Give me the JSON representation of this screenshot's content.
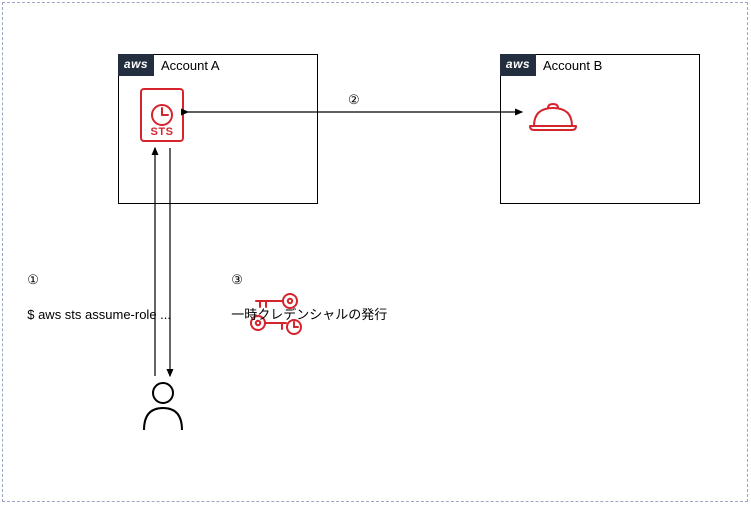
{
  "aws_badge": "aws",
  "accounts": {
    "a": {
      "title": "Account A"
    },
    "b": {
      "title": "Account B"
    }
  },
  "sts": {
    "label": "STS"
  },
  "steps": {
    "one": {
      "num": "①",
      "text": "$ aws sts assume-role ..."
    },
    "two": {
      "num": "②"
    },
    "three": {
      "num": "③",
      "text": "一時クレデンシャルの発行"
    }
  }
}
